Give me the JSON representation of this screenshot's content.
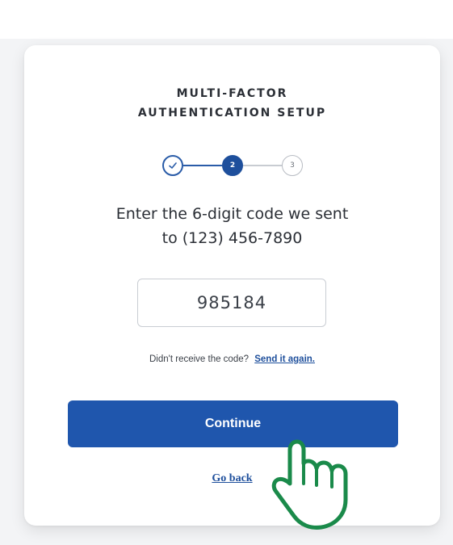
{
  "card": {
    "title_line1": "MULTI-FACTOR",
    "title_line2": "AUTHENTICATION SETUP"
  },
  "stepper": {
    "current_step": 2,
    "steps": [
      {
        "label": "",
        "state": "complete",
        "icon": "check-icon"
      },
      {
        "label": "2",
        "state": "current"
      },
      {
        "label": "3",
        "state": "upcoming"
      }
    ]
  },
  "instruction": {
    "line1": "Enter the 6-digit code we sent",
    "line2": "to (123) 456-7890"
  },
  "code_input": {
    "value": "985184"
  },
  "resend": {
    "prompt": "Didn't receive the code?",
    "link": "Send it again."
  },
  "actions": {
    "continue_label": "Continue",
    "go_back_label": "Go back"
  },
  "colors": {
    "primary": "#1f56ad",
    "link": "#1e4f9c",
    "text": "#2b2f36",
    "cursor_hand": "#1a8a4a"
  }
}
